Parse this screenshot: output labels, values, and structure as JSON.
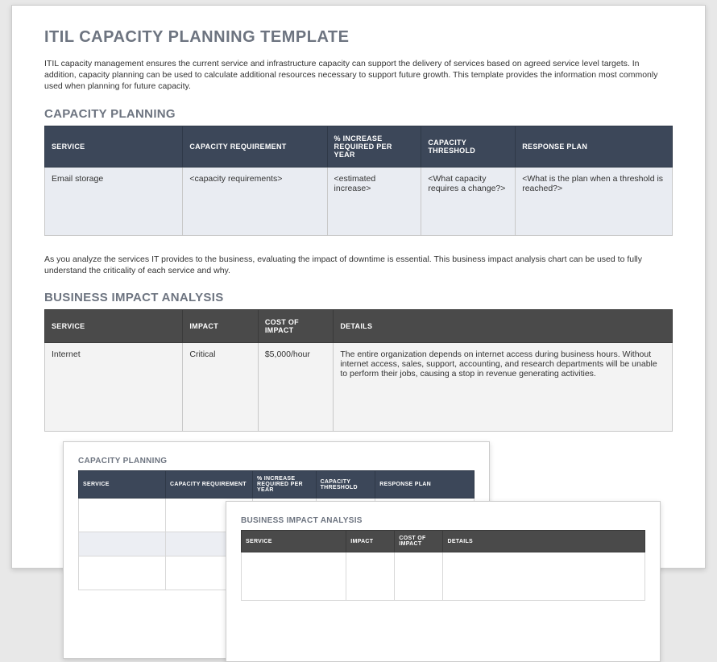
{
  "title": "ITIL CAPACITY PLANNING TEMPLATE",
  "intro": "ITIL capacity management ensures the current service and infrastructure capacity can support the delivery of services based on agreed service level targets. In addition, capacity planning can be used to calculate additional resources necessary to support future growth. This template provides the information most commonly used when planning for future capacity.",
  "cap": {
    "heading": "CAPACITY PLANNING",
    "cols": [
      "SERVICE",
      "CAPACITY REQUIREMENT",
      "% INCREASE REQUIRED PER YEAR",
      "CAPACITY THRESHOLD",
      "RESPONSE PLAN"
    ],
    "row": {
      "service": "Email storage",
      "req": "<capacity requirements>",
      "inc": "<estimated increase>",
      "thresh": "<What capacity requires a change?>",
      "plan": "<What is the plan when a threshold is reached?>"
    }
  },
  "mid_text": "As you analyze the services IT provides to the business, evaluating the impact of downtime is essential. This business impact analysis chart can be used to fully understand the criticality of each service and why.",
  "bia": {
    "heading": "BUSINESS IMPACT ANALYSIS",
    "cols": [
      "SERVICE",
      "IMPACT",
      "COST OF IMPACT",
      "DETAILS"
    ],
    "row": {
      "service": "Internet",
      "impact": "Critical",
      "cost": "$5,000/hour",
      "details": "The entire organization depends on internet access during business hours. Without internet access, sales, support, accounting, and research departments will be unable to perform their jobs, causing a stop in revenue generating activities."
    }
  },
  "thumb1": {
    "heading": "CAPACITY PLANNING",
    "cols": [
      "SERVICE",
      "CAPACITY REQUIREMENT",
      "% INCREASE REQUIRED PER YEAR",
      "CAPACITY THRESHOLD",
      "RESPONSE PLAN"
    ]
  },
  "thumb2": {
    "heading": "BUSINESS IMPACT ANALYSIS",
    "cols": [
      "SERVICE",
      "IMPACT",
      "COST OF IMPACT",
      "DETAILS"
    ]
  }
}
